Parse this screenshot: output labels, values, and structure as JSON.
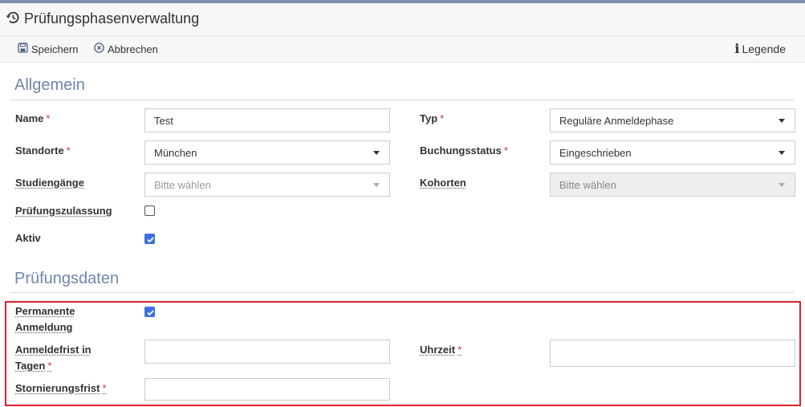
{
  "window": {
    "title": "Prüfungsphasenverwaltung"
  },
  "toolbar": {
    "save_label": "Speichern",
    "cancel_label": "Abbrechen",
    "legend_label": "Legende"
  },
  "sections": {
    "general": "Allgemein",
    "exam_dates": "Prüfungsdaten"
  },
  "general": {
    "name": {
      "label": "Name",
      "required": "*",
      "value": "Test"
    },
    "typ": {
      "label": "Typ",
      "required": "*",
      "value": "Reguläre Anmeldephase"
    },
    "standorte": {
      "label": "Standorte",
      "required": "*",
      "value": "München"
    },
    "buchungsstatus": {
      "label": "Buchungsstatus",
      "required": "*",
      "value": "Eingeschrieben"
    },
    "studiengaenge": {
      "label": "Studiengänge",
      "placeholder": "Bitte wählen"
    },
    "kohorten": {
      "label": "Kohorten",
      "placeholder": "Bitte wählen"
    },
    "pruefungszulassung": {
      "label": "Prüfungszulassung",
      "checked": false
    },
    "aktiv": {
      "label": "Aktiv",
      "checked": true
    }
  },
  "exam_dates": {
    "permanente_anmeldung": {
      "label_line1": "Permanente",
      "label_line2": "Anmeldung",
      "checked": true
    },
    "anmeldefrist": {
      "label_line1": "Anmeldefrist in",
      "label_line2": "Tagen",
      "required": "*",
      "value": ""
    },
    "uhrzeit": {
      "label": "Uhrzeit",
      "required": "*",
      "value": ""
    },
    "stornierungsfrist": {
      "label": "Stornierungsfrist",
      "required": "*",
      "value": ""
    }
  },
  "colors": {
    "accent": "#3d6fe0",
    "section_title": "#6f87ad",
    "required": "#c0392b",
    "highlight": "#d9232d",
    "topbar": "#7f8fa8"
  },
  "icons": {
    "title": "history-icon",
    "save": "floppy-disk-icon",
    "cancel": "circle-x-icon",
    "legend": "info-icon",
    "dropdown": "caret-down-icon",
    "check": "checkmark-icon"
  }
}
